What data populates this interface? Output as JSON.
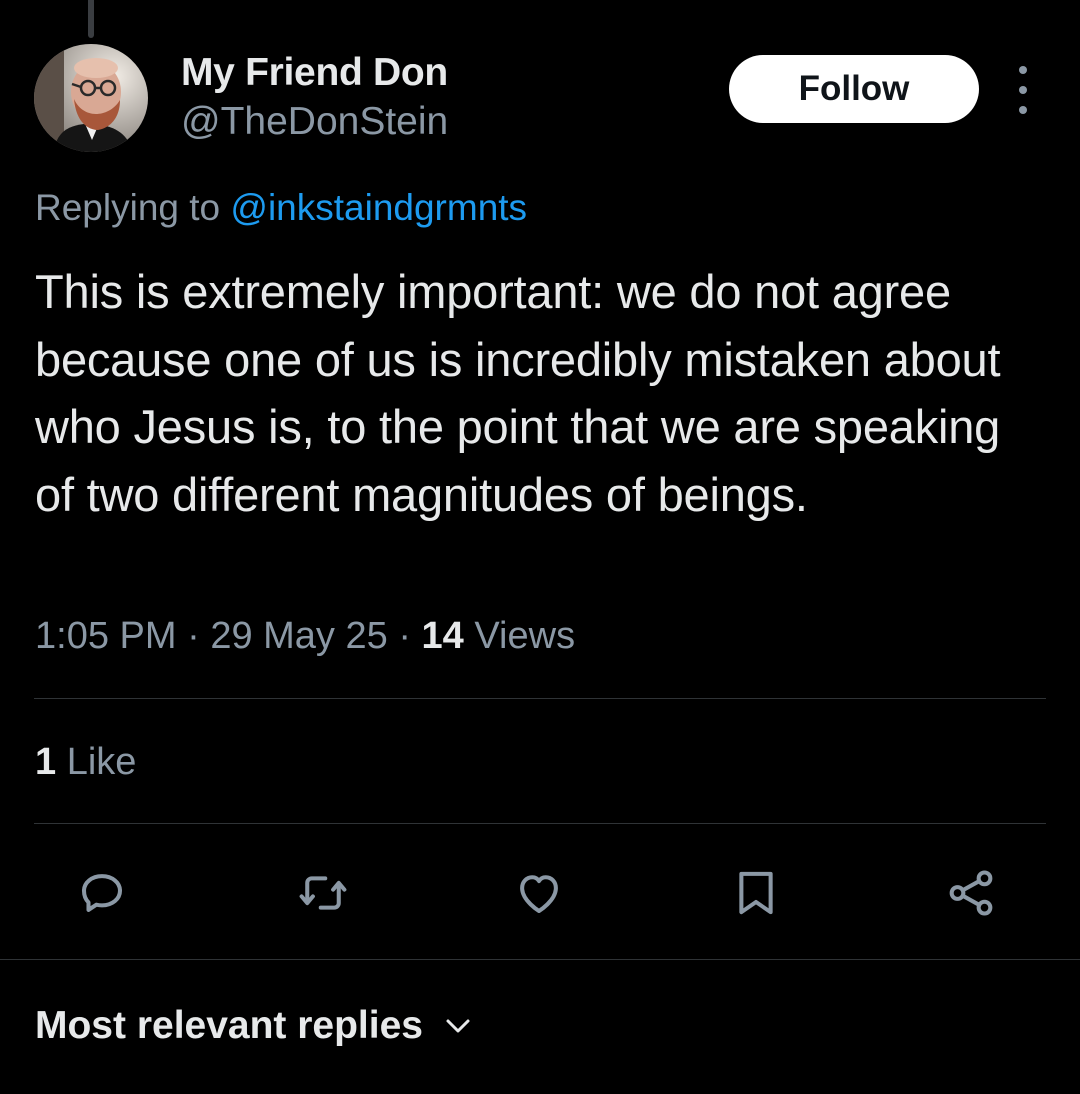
{
  "author": {
    "name": "My Friend Don",
    "handle": "@TheDonStein",
    "avatar_icon": "avatar-photo"
  },
  "follow_label": "Follow",
  "reply_context": {
    "prefix": "Replying to ",
    "mention": "@inkstaindgrmnts"
  },
  "tweet": {
    "text": "This is extremely important: we do not agree because one of us is incredibly mistaken about who Jesus is, to the point that we are speaking of two different magnitudes of beings.",
    "time": "1:05 PM",
    "date": "29 May 25",
    "separator": " · ",
    "views_count": "14",
    "views_label": " Views"
  },
  "engagement": {
    "likes_count": "1",
    "likes_label": " Like"
  },
  "actions": [
    {
      "name": "reply",
      "icon": "reply-icon"
    },
    {
      "name": "retweet",
      "icon": "retweet-icon"
    },
    {
      "name": "like",
      "icon": "heart-icon"
    },
    {
      "name": "bookmark",
      "icon": "bookmark-icon"
    },
    {
      "name": "share",
      "icon": "share-icon"
    }
  ],
  "replies_sort": {
    "label": "Most relevant replies",
    "icon": "chevron-down-icon"
  },
  "colors": {
    "background": "#000000",
    "text_primary": "#e7e9ea",
    "text_secondary": "#8b98a5",
    "link": "#1d9bf0",
    "divider": "#2f3336",
    "follow_bg": "#ffffff",
    "follow_text": "#0f1419"
  }
}
